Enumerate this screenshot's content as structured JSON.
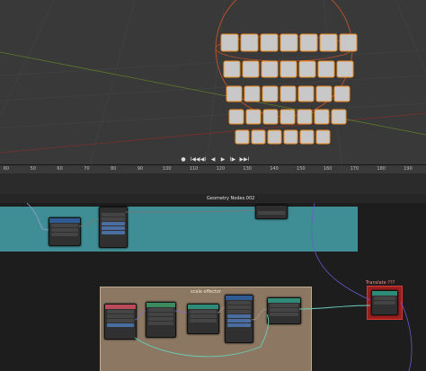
{
  "timeline": {
    "ticks": [
      "60",
      "50",
      "60",
      "70",
      "80",
      "90",
      "100",
      "110",
      "120",
      "130",
      "140",
      "150",
      "160",
      "170",
      "180",
      "190"
    ]
  },
  "playback": {
    "buttons": [
      "●",
      "I◀◀",
      "◀I",
      "◀",
      "▶",
      "I▶",
      "▶▶I"
    ]
  },
  "node_editor": {
    "datablock_name": "Geometry Nodes.002",
    "frame_effector_label": "scale effector",
    "translate_label": "Translate ???"
  },
  "colors": {
    "viewport_bg": "#393939",
    "cube_fill": "#c8c8c8",
    "cube_outline": "#f08a1c",
    "teal_frame": "#3f8e95",
    "effector_frame": "#8c7762",
    "translate_frame": "#9e1f1f"
  }
}
